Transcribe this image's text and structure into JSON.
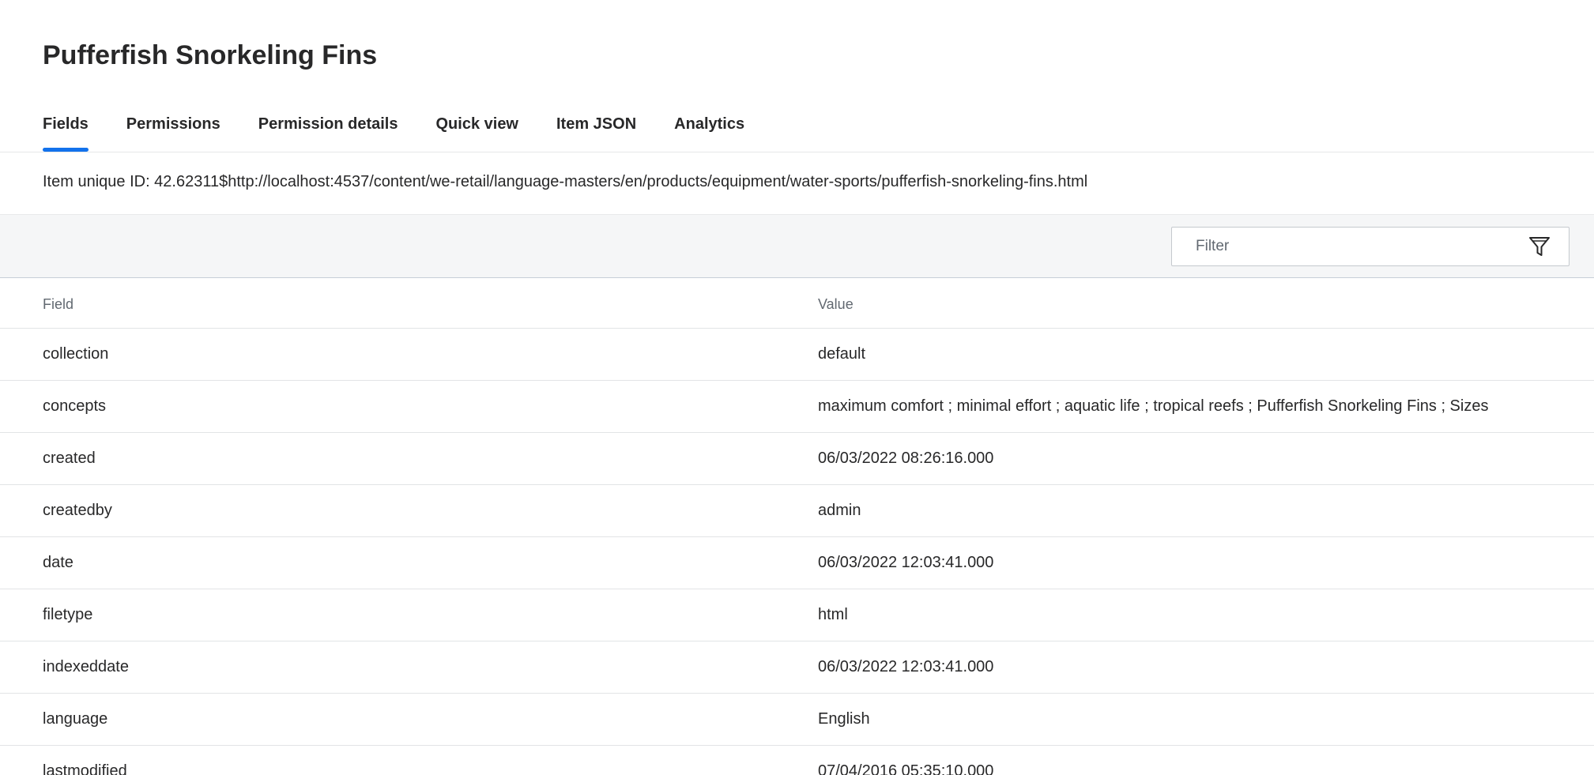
{
  "page": {
    "title": "Pufferfish Snorkeling Fins"
  },
  "tabs": [
    {
      "label": "Fields",
      "active": true
    },
    {
      "label": "Permissions",
      "active": false
    },
    {
      "label": "Permission details",
      "active": false
    },
    {
      "label": "Quick view",
      "active": false
    },
    {
      "label": "Item JSON",
      "active": false
    },
    {
      "label": "Analytics",
      "active": false
    }
  ],
  "item": {
    "unique_id_text": "Item unique ID: 42.62311$http://localhost:4537/content/we-retail/language-masters/en/products/equipment/water-sports/pufferfish-snorkeling-fins.html"
  },
  "filter": {
    "placeholder": "Filter",
    "icon": "funnel-icon"
  },
  "table": {
    "headers": {
      "field": "Field",
      "value": "Value"
    },
    "rows": [
      {
        "field": "collection",
        "value": "default"
      },
      {
        "field": "concepts",
        "value": "maximum comfort ; minimal effort ; aquatic life ; tropical reefs ; Pufferfish Snorkeling Fins ; Sizes"
      },
      {
        "field": "created",
        "value": "06/03/2022 08:26:16.000"
      },
      {
        "field": "createdby",
        "value": "admin"
      },
      {
        "field": "date",
        "value": "06/03/2022 12:03:41.000"
      },
      {
        "field": "filetype",
        "value": "html"
      },
      {
        "field": "indexeddate",
        "value": "06/03/2022 12:03:41.000"
      },
      {
        "field": "language",
        "value": "English"
      },
      {
        "field": "lastmodified",
        "value": "07/04/2016 05:35:10.000"
      }
    ]
  },
  "colors": {
    "accent": "#1372ec",
    "toolbar_bg": "#f5f6f7",
    "text": "#282829",
    "muted": "#626971"
  }
}
